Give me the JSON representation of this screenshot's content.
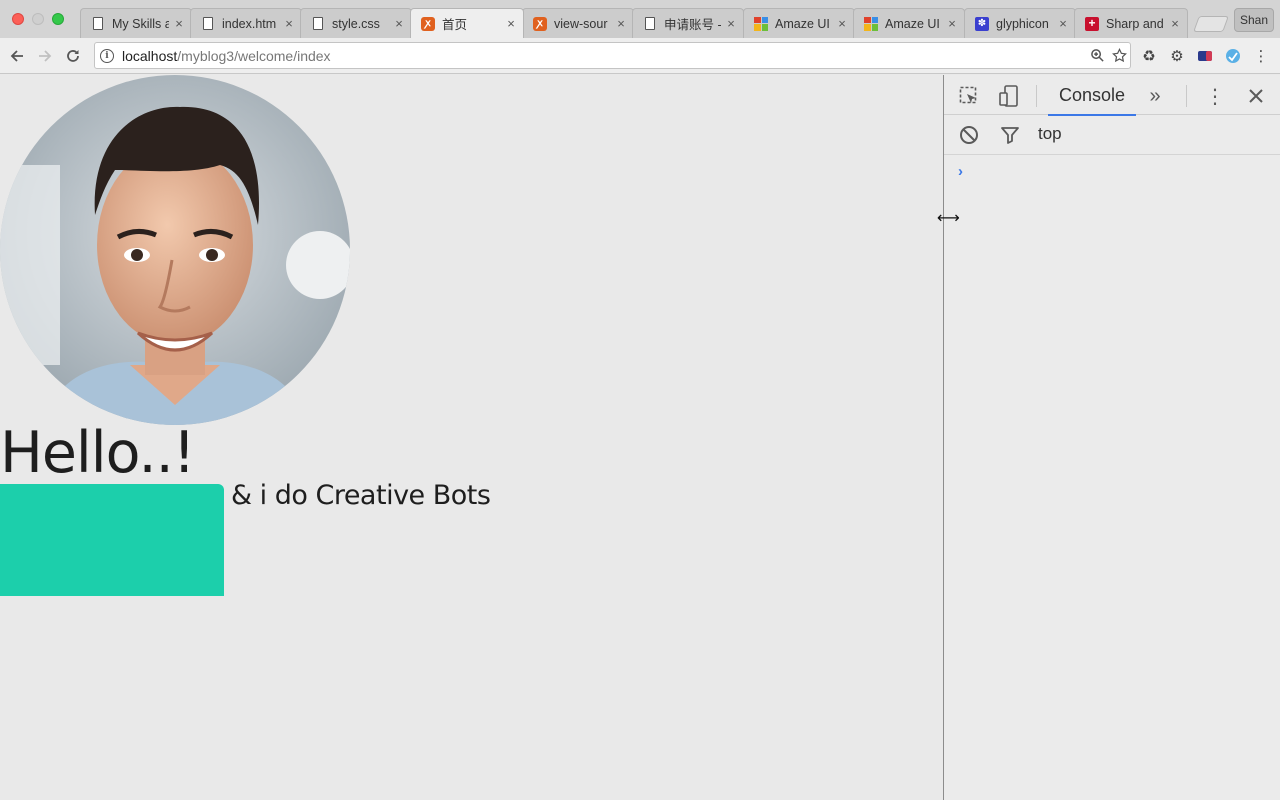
{
  "browser": {
    "tabs": [
      {
        "title": "My Skills a",
        "favicon": "document-icon",
        "active": false
      },
      {
        "title": "index.htm",
        "favicon": "document-icon",
        "active": false
      },
      {
        "title": "style.css",
        "favicon": "document-icon",
        "active": false
      },
      {
        "title": "首页",
        "favicon": "xampp-icon",
        "active": true
      },
      {
        "title": "view-sour",
        "favicon": "xampp-icon",
        "active": false
      },
      {
        "title": "申请账号 -",
        "favicon": "document-icon",
        "active": false
      },
      {
        "title": "Amaze UI",
        "favicon": "amaze-icon",
        "active": false
      },
      {
        "title": "Amaze UI",
        "favicon": "amaze-icon",
        "active": false
      },
      {
        "title": "glyphicon",
        "favicon": "paw-icon",
        "active": false
      },
      {
        "title": "Sharp and",
        "favicon": "swiss-cross-icon",
        "active": false
      }
    ],
    "profile_name": "Shan",
    "close_glyph": "×",
    "url_host": "localhost",
    "url_path": "/myblog3/welcome/index"
  },
  "page": {
    "heading": "Hello..!",
    "tagline": "& i do Creative Bots",
    "accent_color": "#1ccfab"
  },
  "devtools": {
    "active_panel": "Console",
    "more_tabs_glyph": "»",
    "context": "top",
    "prompt_glyph": "›"
  }
}
